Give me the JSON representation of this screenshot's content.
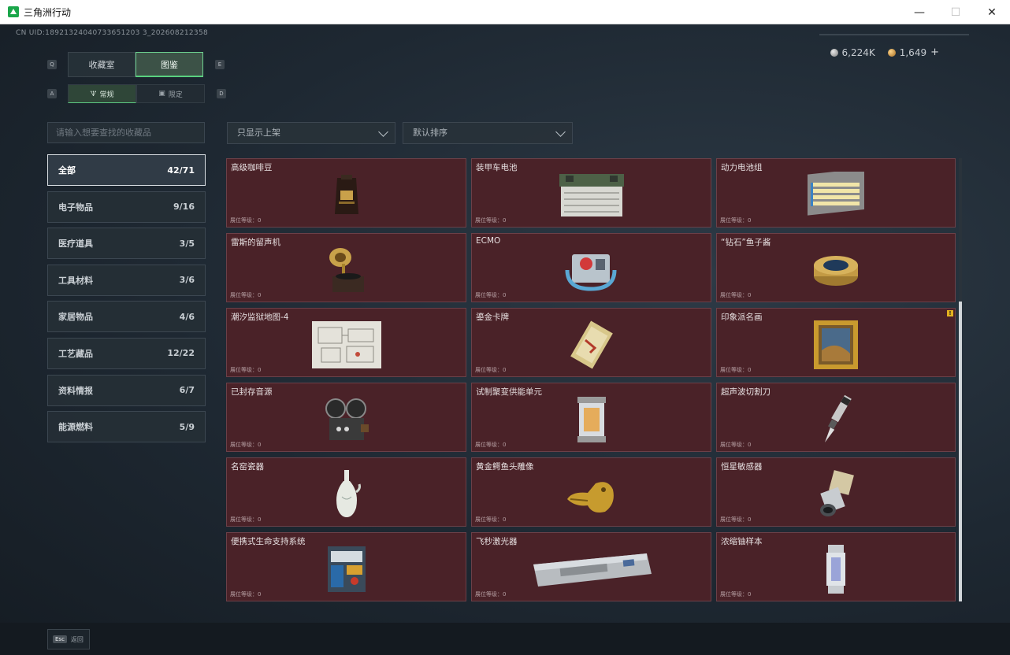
{
  "window": {
    "title": "三角洲行动",
    "minimize": "—",
    "maximize": "☐",
    "close": "✕"
  },
  "uid": "CN UID:18921324040733651203 3_202608212358",
  "currency": {
    "silver": "6,224K",
    "gold": "1,649",
    "plus": "+"
  },
  "keyhints": {
    "q": "Q",
    "e": "E",
    "a": "A",
    "d": "D"
  },
  "tabs": [
    {
      "label": "收藏室",
      "active": false
    },
    {
      "label": "图鉴",
      "active": true
    }
  ],
  "subtabs": [
    {
      "label": "常规",
      "icon": "🝢",
      "active": true
    },
    {
      "label": "限定",
      "icon": "▣",
      "active": false
    }
  ],
  "search": {
    "placeholder": "请输入想要查找的收藏品"
  },
  "filters": {
    "shelf": "只显示上架",
    "sort": "默认排序"
  },
  "categories": [
    {
      "name": "全部",
      "count": "42/71"
    },
    {
      "name": "电子物品",
      "count": "9/16"
    },
    {
      "name": "医疗道具",
      "count": "3/5"
    },
    {
      "name": "工具材料",
      "count": "3/6"
    },
    {
      "name": "家居物品",
      "count": "4/6"
    },
    {
      "name": "工艺藏品",
      "count": "12/22"
    },
    {
      "name": "资料情报",
      "count": "6/7"
    },
    {
      "name": "能源燃料",
      "count": "5/9"
    }
  ],
  "level_label": "展位等级：0",
  "items": [
    {
      "name": "高级咖啡豆",
      "icon": "coffee-bag-icon"
    },
    {
      "name": "装甲车电池",
      "icon": "car-battery-icon"
    },
    {
      "name": "动力电池组",
      "icon": "battery-pack-icon"
    },
    {
      "name": "雷斯的留声机",
      "icon": "gramophone-icon"
    },
    {
      "name": "ECMO",
      "icon": "ecmo-machine-icon"
    },
    {
      "name": "“钻石”鱼子酱",
      "icon": "caviar-tin-icon"
    },
    {
      "name": "潮汐监狱地图-4",
      "icon": "map-icon"
    },
    {
      "name": "鎏金卡牌",
      "icon": "gold-card-icon"
    },
    {
      "name": "印象派名画",
      "icon": "framed-painting-icon"
    },
    {
      "name": "已封存音源",
      "icon": "film-projector-icon"
    },
    {
      "name": "试制聚变供能单元",
      "icon": "fusion-cell-icon"
    },
    {
      "name": "超声波切割刀",
      "icon": "ultrasonic-knife-icon"
    },
    {
      "name": "名窑瓷器",
      "icon": "porcelain-vase-icon"
    },
    {
      "name": "黄金鳄鱼头雕像",
      "icon": "gold-crocodile-icon"
    },
    {
      "name": "恒星敏感器",
      "icon": "star-sensor-icon"
    },
    {
      "name": "便携式生命支持系统",
      "icon": "life-support-icon"
    },
    {
      "name": "飞秒激光器",
      "icon": "laser-device-icon"
    },
    {
      "name": "浓缩铀样本",
      "icon": "uranium-capsule-icon"
    }
  ],
  "bottom": {
    "esc_key": "Esc",
    "back_label": "返回"
  },
  "colors": {
    "card_bg": "#4a2228",
    "accent_green": "#59d17f"
  }
}
